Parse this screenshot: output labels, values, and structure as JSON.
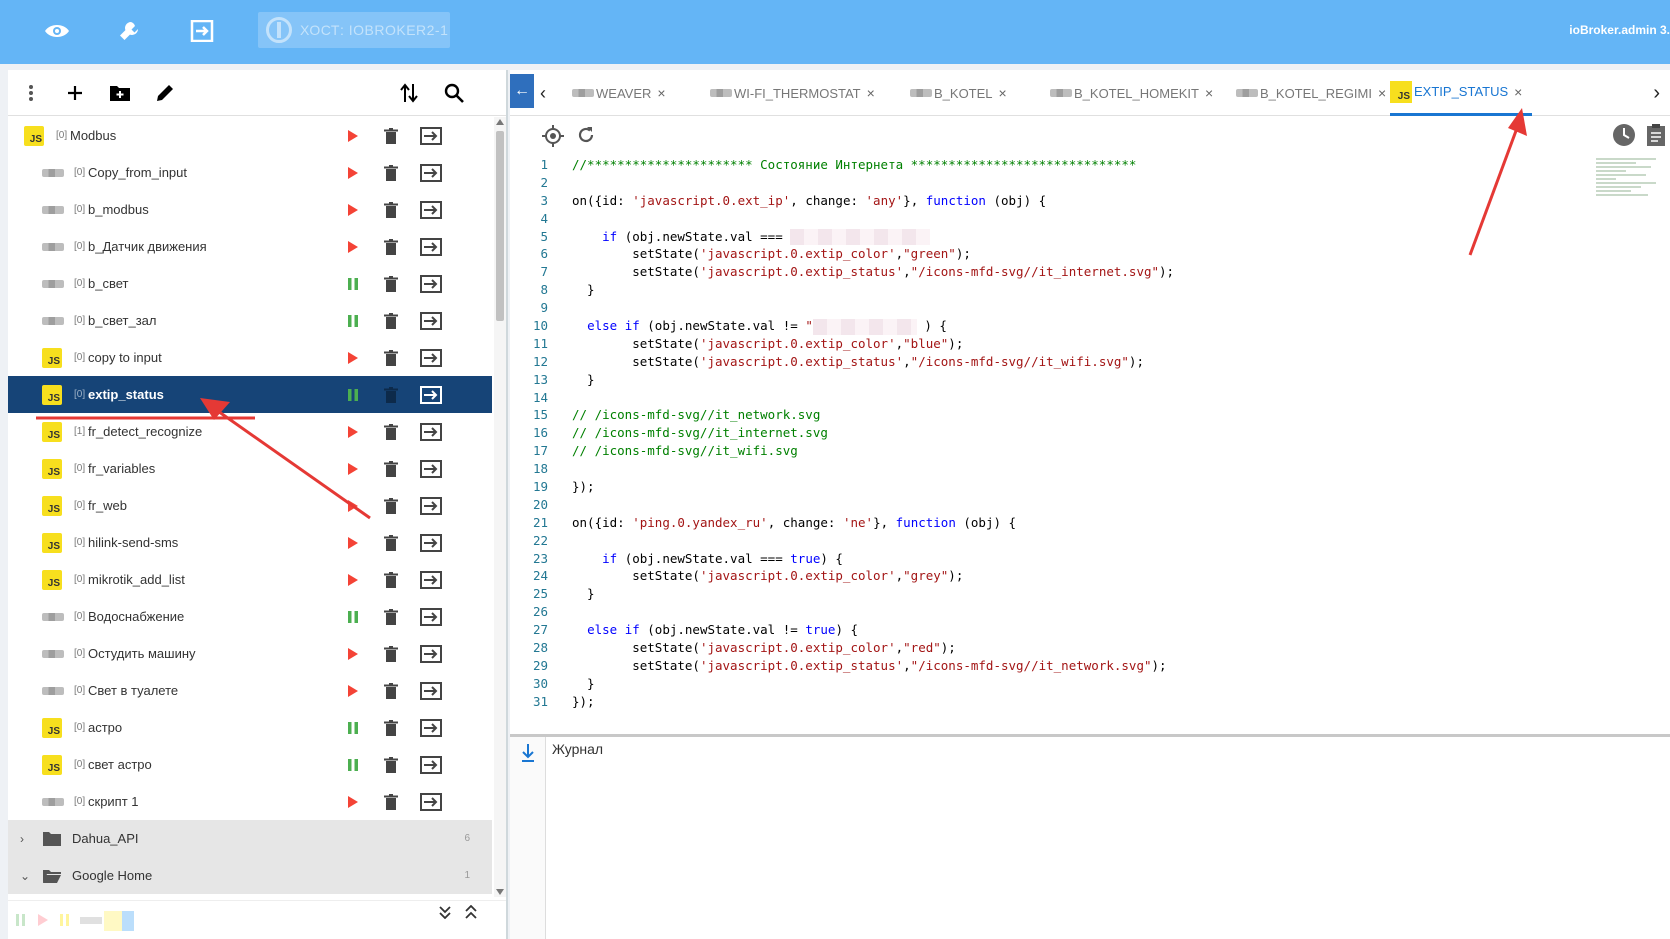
{
  "topbar": {
    "host": "ХОСТ: IOBROKER2-1",
    "user": "ioBroker.admin 3.",
    "icons": [
      "eye-icon",
      "wrench-icon",
      "logout-icon"
    ]
  },
  "left": {
    "toolbar": [
      "more-icon",
      "add-icon",
      "folder-add-icon",
      "edit-icon",
      "sort-icon",
      "search-icon"
    ],
    "scripts": [
      {
        "idx": "[0]",
        "name": "Modbus",
        "type": "js",
        "state": "run",
        "indent": 0
      },
      {
        "idx": "[0]",
        "name": "Copy_from_input",
        "type": "blockly",
        "state": "run",
        "indent": 1
      },
      {
        "idx": "[0]",
        "name": "b_modbus",
        "type": "blockly",
        "state": "run",
        "indent": 1
      },
      {
        "idx": "[0]",
        "name": "b_Датчик движения",
        "type": "blockly",
        "state": "run",
        "indent": 1
      },
      {
        "idx": "[0]",
        "name": "b_свет",
        "type": "blockly",
        "state": "pause",
        "indent": 1
      },
      {
        "idx": "[0]",
        "name": "b_свет_зал",
        "type": "blockly",
        "state": "pause",
        "indent": 1
      },
      {
        "idx": "[0]",
        "name": "copy to input",
        "type": "js",
        "state": "run",
        "indent": 1
      },
      {
        "idx": "[0]",
        "name": "extip_status",
        "type": "js",
        "state": "pause",
        "indent": 1,
        "selected": true
      },
      {
        "idx": "[1]",
        "name": "fr_detect_recognize",
        "type": "js",
        "state": "run",
        "indent": 1
      },
      {
        "idx": "[0]",
        "name": "fr_variables",
        "type": "js",
        "state": "run",
        "indent": 1
      },
      {
        "idx": "[0]",
        "name": "fr_web",
        "type": "js",
        "state": "run",
        "indent": 1
      },
      {
        "idx": "[0]",
        "name": "hilink-send-sms",
        "type": "js",
        "state": "run",
        "indent": 1
      },
      {
        "idx": "[0]",
        "name": "mikrotik_add_list",
        "type": "js",
        "state": "run",
        "indent": 1
      },
      {
        "idx": "[0]",
        "name": "Водоснабжение",
        "type": "blockly",
        "state": "pause",
        "indent": 1
      },
      {
        "idx": "[0]",
        "name": "Остудить машину",
        "type": "blockly",
        "state": "run",
        "indent": 1
      },
      {
        "idx": "[0]",
        "name": "Свет в туалете",
        "type": "blockly",
        "state": "run",
        "indent": 1
      },
      {
        "idx": "[0]",
        "name": "астро",
        "type": "js",
        "state": "pause",
        "indent": 1
      },
      {
        "idx": "[0]",
        "name": "свет астро",
        "type": "js",
        "state": "pause",
        "indent": 1
      },
      {
        "idx": "[0]",
        "name": "скрипт 1",
        "type": "blockly",
        "state": "run",
        "indent": 1
      }
    ],
    "folders": [
      {
        "name": "Dahua_API",
        "count": "6",
        "expanded": false
      },
      {
        "name": "Google Home",
        "count": "1",
        "expanded": true
      }
    ]
  },
  "tabs": [
    {
      "label": "WEAVER",
      "type": "blockly",
      "close": "×"
    },
    {
      "label": "WI-FI_THERMOSTAT",
      "type": "blockly",
      "close": "×"
    },
    {
      "label": "B_KOTEL",
      "type": "blockly",
      "close": "×"
    },
    {
      "label": "B_KOTEL_HOMEKIT",
      "type": "blockly",
      "close": "×"
    },
    {
      "label": "B_KOTEL_REGIMI",
      "type": "blockly",
      "close": "×"
    },
    {
      "label": "EXTIP_STATUS",
      "type": "js",
      "close": "×",
      "active": true
    }
  ],
  "editor": {
    "lines": [
      "1",
      "2",
      "3",
      "4",
      "5",
      "6",
      "7",
      "8",
      "9",
      "10",
      "11",
      "12",
      "13",
      "14",
      "15",
      "16",
      "17",
      "18",
      "19",
      "20",
      "21",
      "22",
      "23",
      "24",
      "25",
      "26",
      "27",
      "28",
      "29",
      "30",
      "31"
    ]
  },
  "log": {
    "title": "Журнал"
  },
  "colors": {
    "topbar": "#64b5f6",
    "selected_row": "#164477",
    "run": "#f44336",
    "pause": "#4caf50",
    "accent": "#1976d2"
  }
}
